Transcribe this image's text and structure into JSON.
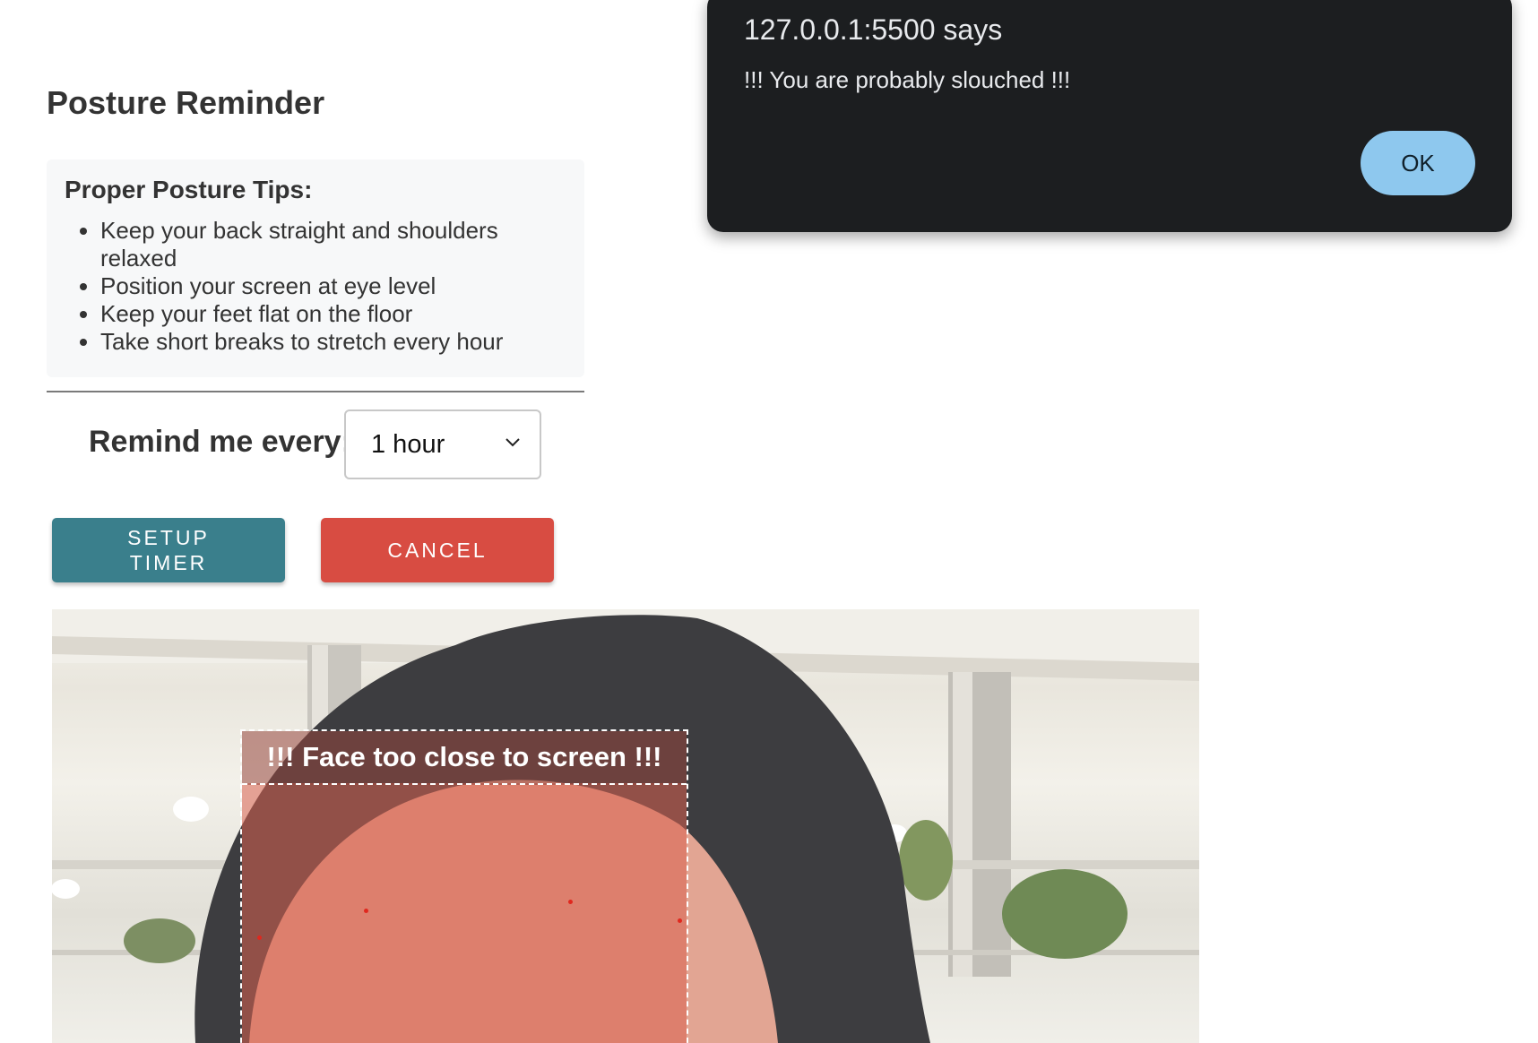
{
  "app": {
    "title": "Posture Reminder"
  },
  "tips": {
    "heading": "Proper Posture Tips:",
    "items": [
      "Keep your back straight and shoulders relaxed",
      "Position your screen at eye level",
      "Keep your feet flat on the floor",
      "Take short breaks to stretch every hour"
    ]
  },
  "reminder": {
    "label": "Remind me every:",
    "selected": "1 hour"
  },
  "buttons": {
    "setup": "SETUP TIMER",
    "cancel": "CANCEL"
  },
  "camera": {
    "warning": "!!! Face too close to screen !!!"
  },
  "alert": {
    "origin": "127.0.0.1:5500 says",
    "message": "!!! You are probably slouched !!!",
    "ok": "OK"
  },
  "colors": {
    "setup_button": "#3a7f8c",
    "cancel_button": "#d84c42",
    "alert_background": "#1c1e20",
    "alert_ok": "#8ec8ee",
    "face_overlay": "#d9604f"
  }
}
